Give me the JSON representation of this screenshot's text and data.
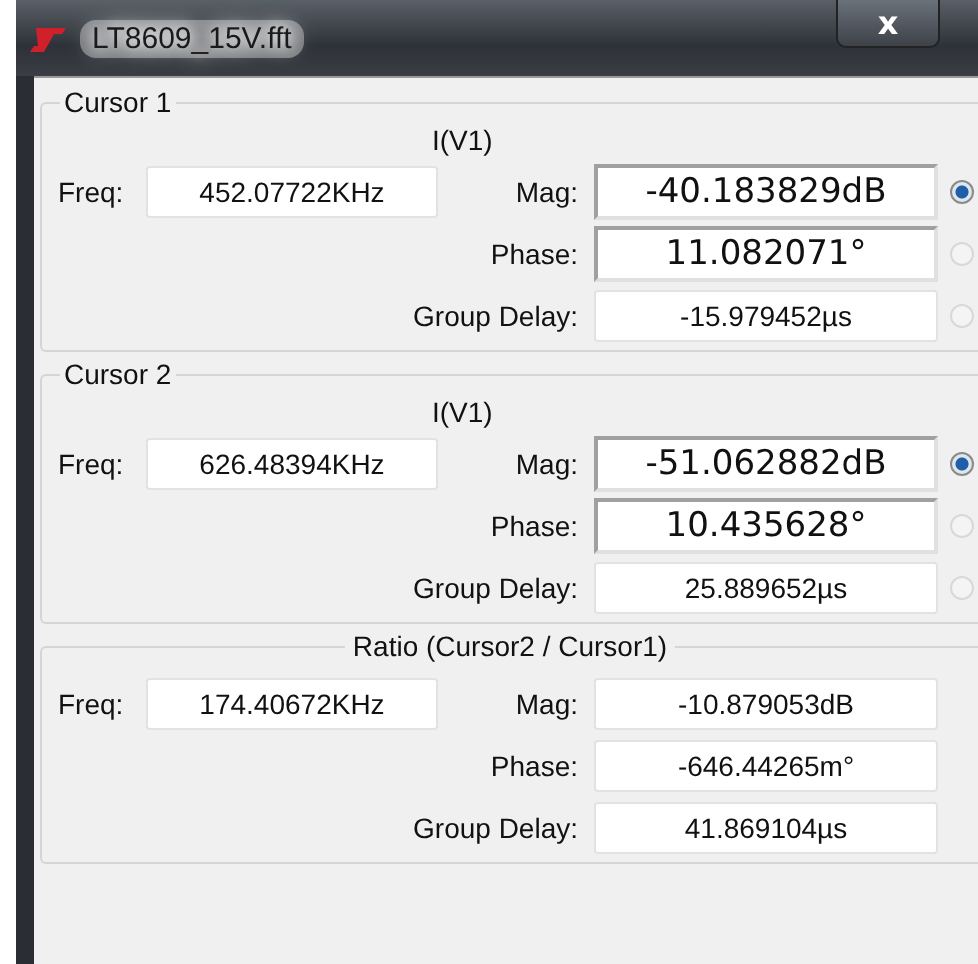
{
  "window": {
    "title": "LT8609_15V.fft",
    "close": "x"
  },
  "groups": [
    {
      "kind": "cursor",
      "title": "Cursor 1",
      "signal": "I(V1)",
      "freq_label": "Freq:",
      "freq": "452.07722KHz",
      "rows": [
        {
          "label": "Mag:",
          "value": "-40.183829dB",
          "editable": true,
          "selected": true
        },
        {
          "label": "Phase:",
          "value": "11.082071°",
          "editable": true,
          "selected": false
        },
        {
          "label": "Group Delay:",
          "value": "-15.979452µs",
          "editable": false,
          "selected": false
        }
      ]
    },
    {
      "kind": "cursor",
      "title": "Cursor 2",
      "signal": "I(V1)",
      "freq_label": "Freq:",
      "freq": "626.48394KHz",
      "rows": [
        {
          "label": "Mag:",
          "value": "-51.062882dB",
          "editable": true,
          "selected": true
        },
        {
          "label": "Phase:",
          "value": "10.435628°",
          "editable": true,
          "selected": false
        },
        {
          "label": "Group Delay:",
          "value": "25.889652µs",
          "editable": false,
          "selected": false
        }
      ]
    },
    {
      "kind": "ratio",
      "title": "Ratio (Cursor2 / Cursor1)",
      "freq_label": "Freq:",
      "freq": "174.40672KHz",
      "rows": [
        {
          "label": "Mag:",
          "value": "-10.879053dB",
          "editable": false
        },
        {
          "label": "Phase:",
          "value": "-646.44265m°",
          "editable": false
        },
        {
          "label": "Group Delay:",
          "value": "41.869104µs",
          "editable": false
        }
      ]
    }
  ]
}
